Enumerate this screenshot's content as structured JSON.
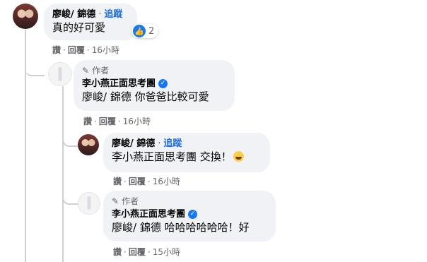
{
  "comments": [
    {
      "name": "廖峻/ 錦德",
      "follow": "追蹤",
      "text": "真的好可愛",
      "reaction_count": "2",
      "actions": {
        "like": "讚",
        "reply": "回覆",
        "time": "16小時"
      }
    },
    {
      "author_badge": "作者",
      "name": "李小燕正面思考團",
      "mention": "廖峻/ 錦德",
      "text": "你爸爸比較可愛",
      "actions": {
        "like": "讚",
        "reply": "回覆",
        "time": "16小時"
      }
    },
    {
      "name": "廖峻/ 錦德",
      "follow": "追蹤",
      "mention": "李小燕正面思考團",
      "text": "交換！",
      "emoji": "rolling-laughing-emoji",
      "actions": {
        "like": "讚",
        "reply": "回覆",
        "time": "16小時"
      }
    },
    {
      "author_badge": "作者",
      "name": "李小燕正面思考團",
      "mention": "廖峻/ 錦德",
      "text": "哈哈哈哈哈哈！好",
      "actions": {
        "like": "讚",
        "reply": "回覆",
        "time": "15小時"
      }
    }
  ],
  "separator": "·",
  "colors": {
    "bubble": "#f0f2f5",
    "link": "#216fdb",
    "meta": "#65676b",
    "verified": "#1877f2"
  }
}
